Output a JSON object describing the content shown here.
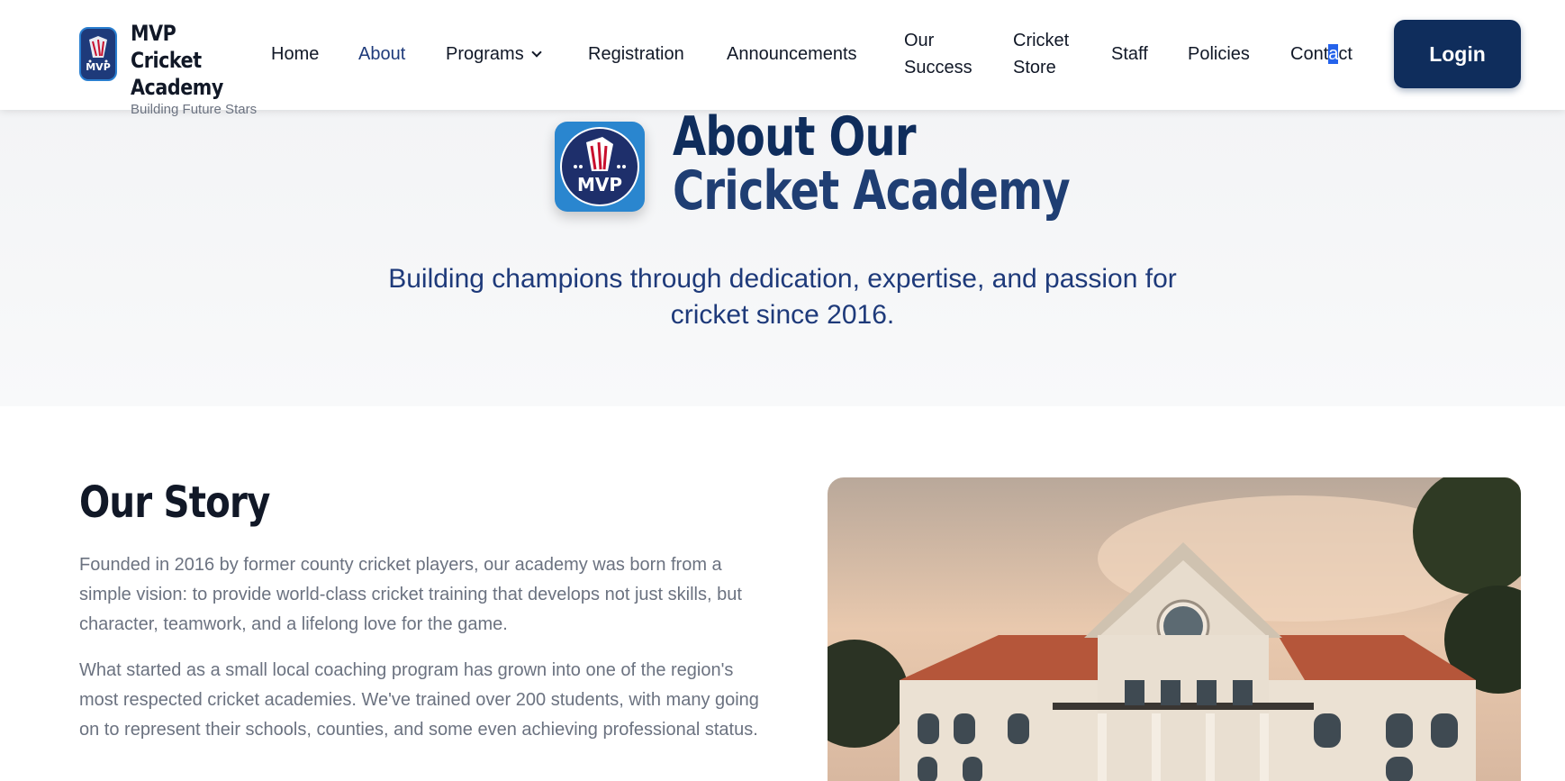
{
  "brand": {
    "title": "MVP Cricket Academy",
    "tagline": "Building Future Stars"
  },
  "nav": {
    "home": "Home",
    "about": "About",
    "programs": "Programs",
    "registration": "Registration",
    "announcements": "Announcements",
    "success_line1": "Our",
    "success_line2": "Success",
    "store_line1": "Cricket",
    "store_line2": "Store",
    "staff": "Staff",
    "policies": "Policies",
    "contact_a": "Cont",
    "contact_sel": "a",
    "contact_b": "ct",
    "login": "Login"
  },
  "hero": {
    "title_line1": "About Our",
    "title_line2": "Cricket Academy",
    "subtitle_line1": "Building champions through dedication, expertise, and passion for",
    "subtitle_line2": "cricket since 2016."
  },
  "story": {
    "title": "Our Story",
    "paragraph1": "Founded in 2016 by former county cricket players, our academy was born from a simple vision: to provide world-class cricket training that develops not just skills, but character, teamwork, and a lifelong love for the game.",
    "paragraph2": "What started as a small local coaching program has grown into one of the region's most respected cricket academies. We've trained over 200 students, with many going on to represent their schools, counties, and some even achieving professional status."
  },
  "colors": {
    "primary": "#0f2d5c",
    "active_nav": "#1e3a7a",
    "text_muted": "#6b7280"
  },
  "icons": {
    "logo": "mvp-cricket-logo",
    "dropdown": "chevron-down-icon"
  },
  "logo_text": "MVP"
}
